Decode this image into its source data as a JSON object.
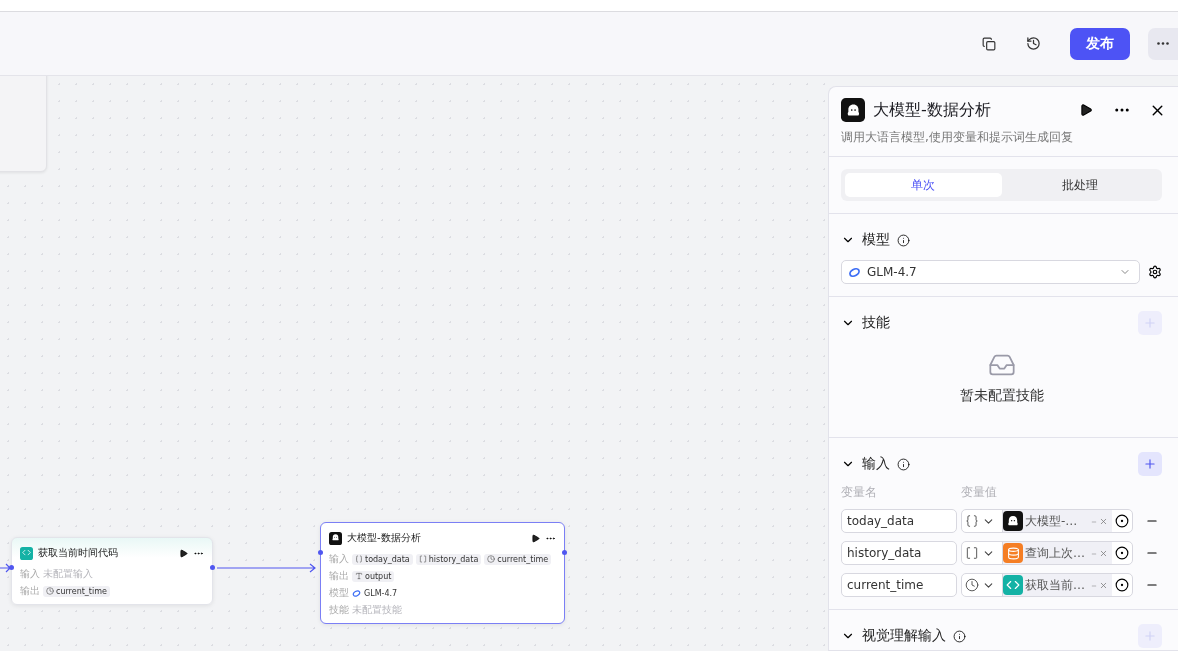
{
  "header": {
    "publish_label": "发布"
  },
  "canvas": {
    "nodes": [
      {
        "kind": "code",
        "title": "获取当前时间代码",
        "selected": false,
        "rows": [
          {
            "label": "输入",
            "empty": "未配置输入"
          },
          {
            "label": "输出",
            "tags": [
              {
                "kind": "time",
                "text": "current_time"
              }
            ]
          }
        ]
      },
      {
        "kind": "llm",
        "title": "大模型-数据分析",
        "selected": true,
        "rows": [
          {
            "label": "输入",
            "tags": [
              {
                "kind": "object",
                "text": "today_data"
              },
              {
                "kind": "array",
                "text": "history_data"
              },
              {
                "kind": "time",
                "text": "current_time"
              }
            ]
          },
          {
            "label": "输出",
            "tags": [
              {
                "kind": "string",
                "text": "output"
              }
            ]
          },
          {
            "label": "模型",
            "model": "GLM-4.7"
          },
          {
            "label": "技能",
            "empty": "未配置技能"
          }
        ]
      }
    ]
  },
  "panel": {
    "title": "大模型-数据分析",
    "description": "调用大语言模型,使用变量和提示词生成回复",
    "tabs": [
      {
        "label": "单次",
        "selected": true
      },
      {
        "label": "批处理",
        "selected": false
      }
    ],
    "sections": [
      {
        "kind": "model",
        "title": "模型",
        "info": true,
        "model": "GLM-4.7"
      },
      {
        "kind": "skills",
        "title": "技能",
        "add_disabled": true,
        "empty": "暂未配置技能"
      },
      {
        "kind": "inputs",
        "title": "输入",
        "info": true,
        "add_disabled": false,
        "name_header": "变量名",
        "value_header": "变量值",
        "rows": [
          {
            "name": "today_data",
            "type": {
              "kind": "object"
            },
            "source": {
              "kind": "llm",
              "label": "大模型-…"
            }
          },
          {
            "name": "history_data",
            "type": {
              "kind": "array"
            },
            "source": {
              "kind": "database",
              "label": "查询上次…"
            }
          },
          {
            "name": "current_time",
            "type": {
              "kind": "time"
            },
            "source": {
              "kind": "code",
              "label": "获取当前…"
            }
          }
        ]
      },
      {
        "kind": "vision",
        "title": "视觉理解输入",
        "info": true,
        "add_disabled": true
      }
    ]
  }
}
